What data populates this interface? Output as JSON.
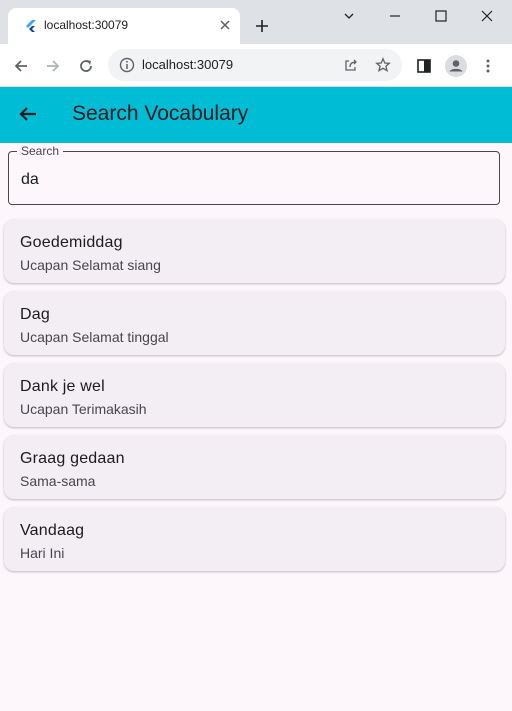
{
  "browser": {
    "tab_title": "localhost:30079",
    "url": "localhost:30079"
  },
  "app": {
    "title": "Search Vocabulary",
    "accent": "#00bcd4"
  },
  "search": {
    "label": "Search",
    "value": "da"
  },
  "results": [
    {
      "word": "Goedemiddag",
      "meaning": "Ucapan Selamat siang"
    },
    {
      "word": "Dag",
      "meaning": "Ucapan Selamat tinggal"
    },
    {
      "word": "Dank je wel",
      "meaning": "Ucapan Terimakasih"
    },
    {
      "word": "Graag gedaan",
      "meaning": "Sama-sama"
    },
    {
      "word": "Vandaag",
      "meaning": "Hari Ini"
    }
  ]
}
